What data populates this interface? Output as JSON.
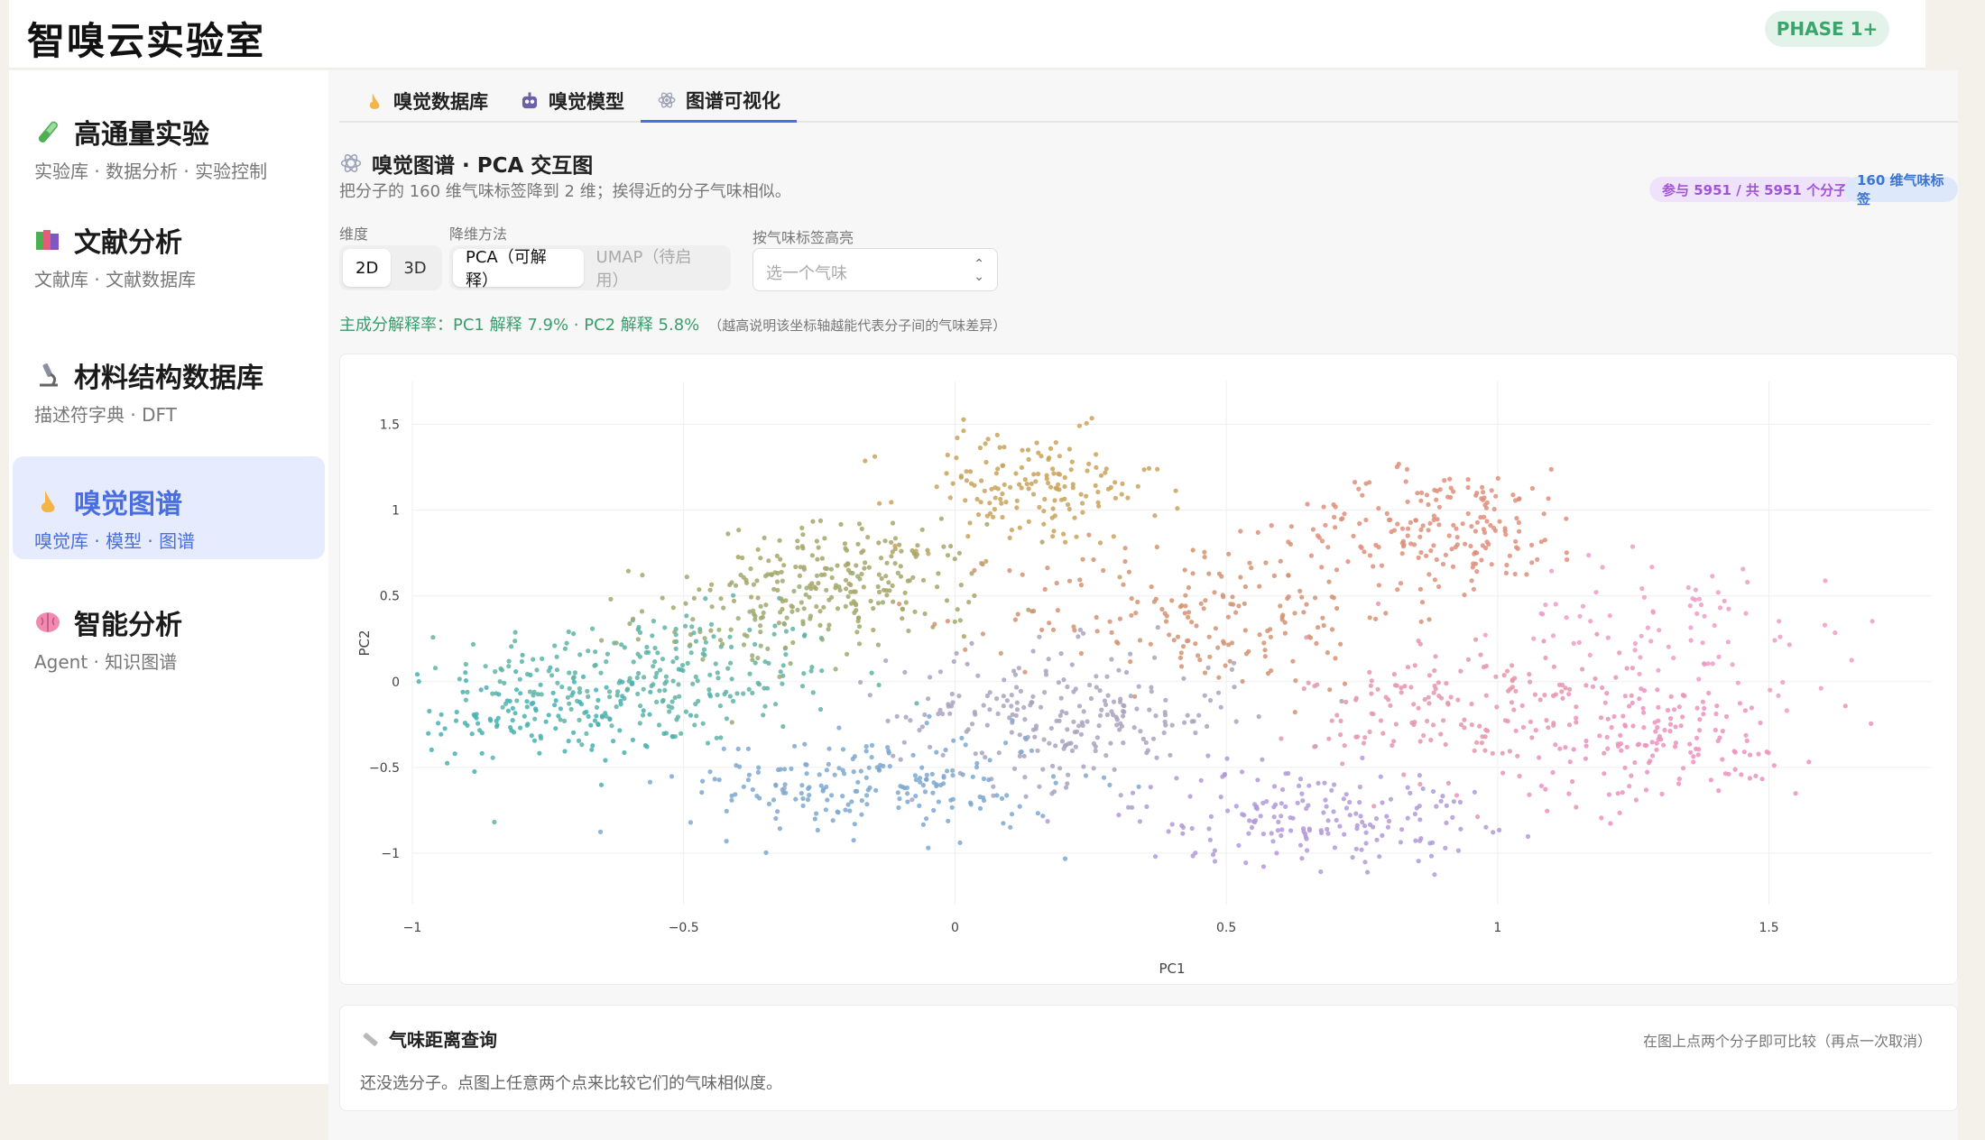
{
  "app": {
    "title": "智嗅云实验室",
    "phase": "PHASE 1+"
  },
  "sidebar": {
    "items": [
      {
        "label": "高通量实验",
        "sub": "实验库 · 数据分析 · 实验控制",
        "icon": "test-tube-icon"
      },
      {
        "label": "文献分析",
        "sub": "文献库 · 文献数据库",
        "icon": "books-icon"
      },
      {
        "label": "材料结构数据库",
        "sub": "描述符字典 · DFT",
        "icon": "microscope-icon"
      },
      {
        "label": "嗅觉图谱",
        "sub": "嗅觉库 · 模型 · 图谱",
        "icon": "nose-icon",
        "active": true
      },
      {
        "label": "智能分析",
        "sub": "Agent · 知识图谱",
        "icon": "brain-icon"
      }
    ]
  },
  "tabs": [
    {
      "label": "嗅觉数据库",
      "icon": "nose-icon"
    },
    {
      "label": "嗅觉模型",
      "icon": "robot-icon"
    },
    {
      "label": "图谱可视化",
      "icon": "atom-icon",
      "active": true
    }
  ],
  "section": {
    "title": "嗅觉图谱 · PCA 交互图",
    "desc": "把分子的 160 维气味标签降到 2 维；挨得近的分子气味相似。",
    "badge_count": "参与 5951 / 共 5951 个分子",
    "badge_dims": "160 维气味标签"
  },
  "controls": {
    "dim_label": "维度",
    "dim_options": [
      "2D",
      "3D"
    ],
    "dim_selected": "2D",
    "method_label": "降维方法",
    "method_options": [
      "PCA（可解释）",
      "UMAP（待启用）"
    ],
    "method_selected": "PCA（可解释）",
    "highlight_label": "按气味标签高亮",
    "highlight_placeholder": "选一个气味"
  },
  "pca_info": {
    "text": "主成分解释率：PC1 解释 7.9% · PC2 解释 5.8%",
    "note": "（越高说明该坐标轴越能代表分子间的气味差异）"
  },
  "chart_data": {
    "type": "scatter",
    "title": "",
    "xlabel": "PC1",
    "ylabel": "PC2",
    "xlim": [
      -1.0,
      1.8
    ],
    "ylim": [
      -1.3,
      1.75
    ],
    "xticks": [
      -1,
      -0.5,
      0,
      0.5,
      1,
      1.5
    ],
    "yticks": [
      -1,
      -0.5,
      0,
      0.5,
      1,
      1.5
    ],
    "xtick_labels": [
      "−1",
      "−0.5",
      "0",
      "0.5",
      "1",
      "1.5"
    ],
    "ytick_labels": [
      "−1",
      "−0.5",
      "0",
      "0.5",
      "1",
      "1.5"
    ],
    "grid": true,
    "color_map": "position-based hue (teal → olive → gold → salmon → pink, blue → purple lower band)",
    "clusters": [
      {
        "cx": -0.57,
        "cy": 0.02,
        "sx": 0.18,
        "sy": 0.2,
        "n": 260,
        "color": "#5fb3a6"
      },
      {
        "cx": -0.78,
        "cy": -0.2,
        "sx": 0.14,
        "sy": 0.14,
        "n": 130,
        "color": "#48b1b4"
      },
      {
        "cx": -0.2,
        "cy": 0.6,
        "sx": 0.12,
        "sy": 0.16,
        "n": 200,
        "color": "#a7a66a"
      },
      {
        "cx": -0.35,
        "cy": 0.38,
        "sx": 0.12,
        "sy": 0.16,
        "n": 90,
        "color": "#9aab72"
      },
      {
        "cx": 0.14,
        "cy": 1.12,
        "sx": 0.12,
        "sy": 0.17,
        "n": 160,
        "color": "#c9a35b"
      },
      {
        "cx": 0.46,
        "cy": 0.4,
        "sx": 0.18,
        "sy": 0.22,
        "n": 180,
        "color": "#d49372"
      },
      {
        "cx": 0.9,
        "cy": 0.9,
        "sx": 0.14,
        "sy": 0.17,
        "n": 190,
        "color": "#df8e7a"
      },
      {
        "cx": 0.2,
        "cy": -0.2,
        "sx": 0.16,
        "sy": 0.2,
        "n": 240,
        "color": "#a9a2c0"
      },
      {
        "cx": -0.15,
        "cy": -0.6,
        "sx": 0.17,
        "sy": 0.15,
        "n": 200,
        "color": "#7ea8cf"
      },
      {
        "cx": 0.65,
        "cy": -0.78,
        "sx": 0.16,
        "sy": 0.14,
        "n": 180,
        "color": "#b29ad8"
      },
      {
        "cx": 0.95,
        "cy": -0.15,
        "sx": 0.15,
        "sy": 0.22,
        "n": 170,
        "color": "#e596ad"
      },
      {
        "cx": 1.3,
        "cy": -0.35,
        "sx": 0.14,
        "sy": 0.18,
        "n": 150,
        "color": "#ec92bd"
      },
      {
        "cx": 1.35,
        "cy": 0.35,
        "sx": 0.16,
        "sy": 0.2,
        "n": 80,
        "color": "#ed9cc6"
      }
    ]
  },
  "query": {
    "title": "气味距离查询",
    "hint": "在图上点两个分子即可比较（再点一次取消）",
    "empty": "还没选分子。点图上任意两个点来比较它们的气味相似度。"
  }
}
